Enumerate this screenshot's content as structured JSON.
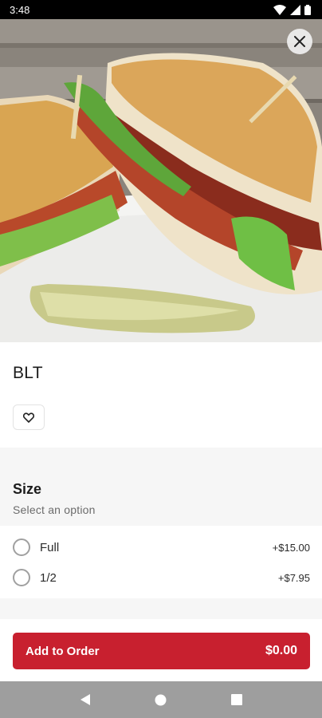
{
  "status_bar": {
    "time": "3:48",
    "icons": [
      "wifi-icon",
      "signal-icon",
      "battery-icon"
    ]
  },
  "hero": {
    "image": "blt-sandwich-photo",
    "close_icon": "close-icon"
  },
  "item": {
    "title": "BLT",
    "favorite_icon": "heart-outline-icon"
  },
  "size": {
    "heading": "Size",
    "subheading": "Select an option",
    "options": [
      {
        "label": "Full",
        "price": "+$15.00"
      },
      {
        "label": "1/2",
        "price": "+$7.95"
      }
    ]
  },
  "cta": {
    "label": "Add to Order",
    "total": "$0.00"
  },
  "nav": {
    "buttons": [
      "back-icon",
      "home-icon",
      "recents-icon"
    ]
  },
  "colors": {
    "accent": "#c8202f",
    "section_bg": "#f6f6f6",
    "nav_bg": "#9e9e9e"
  }
}
